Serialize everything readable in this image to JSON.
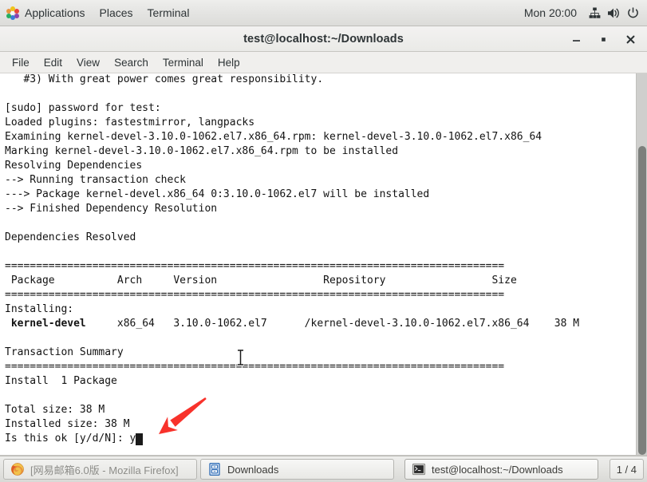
{
  "top_panel": {
    "apps_icon": "applications-pinwheel-icon",
    "menus": [
      {
        "label": "Applications"
      },
      {
        "label": "Places"
      },
      {
        "label": "Terminal"
      }
    ],
    "clock": "Mon 20:00",
    "tray": [
      {
        "icon": "network-icon"
      },
      {
        "icon": "volume-icon"
      },
      {
        "icon": "power-icon"
      }
    ]
  },
  "window": {
    "title": "test@localhost:~/Downloads",
    "minimize_label": "—",
    "maximize_label": "▫",
    "close_label": "✕",
    "menubar": [
      {
        "label": "File"
      },
      {
        "label": "Edit"
      },
      {
        "label": "View"
      },
      {
        "label": "Search"
      },
      {
        "label": "Terminal"
      },
      {
        "label": "Help"
      }
    ]
  },
  "terminal": {
    "lines": [
      {
        "text": "   #3) With great power comes great responsibility."
      },
      {
        "text": ""
      },
      {
        "text": "[sudo] password for test:"
      },
      {
        "text": "Loaded plugins: fastestmirror, langpacks"
      },
      {
        "text": "Examining kernel-devel-3.10.0-1062.el7.x86_64.rpm: kernel-devel-3.10.0-1062.el7.x86_64"
      },
      {
        "text": "Marking kernel-devel-3.10.0-1062.el7.x86_64.rpm to be installed"
      },
      {
        "text": "Resolving Dependencies"
      },
      {
        "text": "--> Running transaction check"
      },
      {
        "text": "---> Package kernel-devel.x86_64 0:3.10.0-1062.el7 will be installed"
      },
      {
        "text": "--> Finished Dependency Resolution"
      },
      {
        "text": ""
      },
      {
        "text": "Dependencies Resolved"
      },
      {
        "text": ""
      },
      {
        "text": "================================================================================"
      },
      {
        "text": " Package          Arch     Version                 Repository                 Size"
      },
      {
        "text": "================================================================================"
      },
      {
        "text": "Installing:"
      },
      {
        "text": " kernel-devel     x86_64   3.10.0-1062.el7      /kernel-devel-3.10.0-1062.el7.x86_64    38 M",
        "bold_prefix": " kernel-devel"
      },
      {
        "text": ""
      },
      {
        "text": "Transaction Summary"
      },
      {
        "text": "================================================================================"
      },
      {
        "text": "Install  1 Package"
      },
      {
        "text": ""
      },
      {
        "text": "Total size: 38 M"
      },
      {
        "text": "Installed size: 38 M"
      },
      {
        "text": "Is this ok [y/d/N]: y"
      }
    ],
    "cursor_char": "y",
    "scrollbar": {
      "thumb_top_pct": 19,
      "thumb_height_pct": 81
    }
  },
  "annotation": {
    "arrow_color": "#f8322b",
    "arrow_name": "red-pointer-arrow"
  },
  "taskbar": {
    "items": [
      {
        "label": "[网易邮箱6.0版 - Mozilla Firefox]",
        "icon": "firefox-icon",
        "state": "inactive"
      },
      {
        "label": "Downloads",
        "icon": "file-manager-icon",
        "state": "normal"
      },
      {
        "label": "test@localhost:~/Downloads",
        "icon": "terminal-icon",
        "state": "active"
      }
    ],
    "workspace": "1 / 4"
  }
}
